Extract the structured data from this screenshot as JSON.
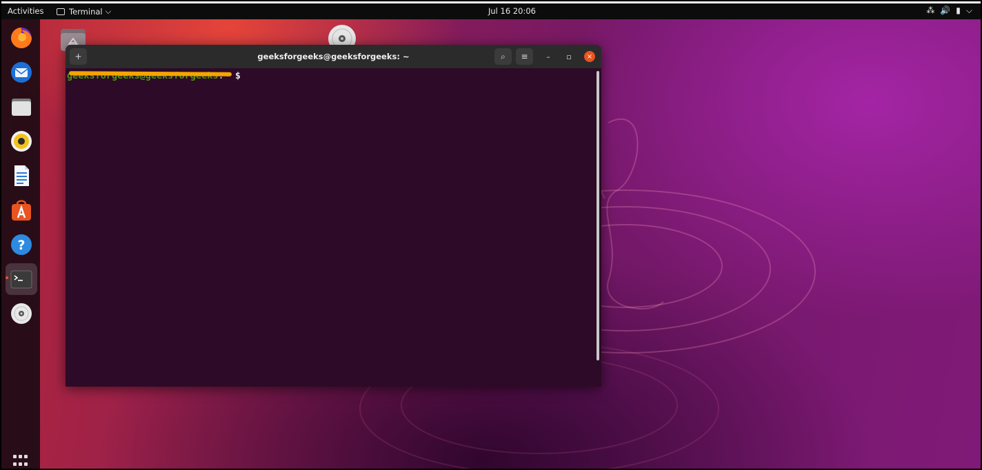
{
  "topbar": {
    "activities": "Activities",
    "app_name": "Terminal",
    "app_chevron": "⌵",
    "clock": "Jul 16  20:06",
    "tray": {
      "network": "⁂",
      "volume": "🔊",
      "battery": "▮",
      "menu": "⌵"
    }
  },
  "dock": {
    "items": [
      {
        "name": "firefox-icon",
        "active": false
      },
      {
        "name": "thunderbird-icon",
        "active": false
      },
      {
        "name": "files-icon",
        "active": false
      },
      {
        "name": "rhythmbox-icon",
        "active": false
      },
      {
        "name": "libreoffice-writer-icon",
        "active": false
      },
      {
        "name": "software-center-icon",
        "active": false
      },
      {
        "name": "help-icon",
        "active": false
      },
      {
        "name": "terminal-icon",
        "active": true
      },
      {
        "name": "dvd-drive-icon",
        "active": false
      }
    ],
    "show_apps": "show-applications-icon"
  },
  "desktop": {
    "icons": [
      "home-folder-icon",
      "disc-icon"
    ]
  },
  "window": {
    "title": "geeksforgeeks@geeksforgeeks: ~",
    "new_tab": "+",
    "search_glyph": "⌕",
    "menu_glyph": "≡",
    "minimize": "–",
    "maximize": "▫",
    "close": "×"
  },
  "terminal": {
    "prompt_user": "geeksforgeeks@geeksforgeeks",
    "prompt_sep": ":",
    "prompt_path": "~",
    "prompt_symbol": "$"
  },
  "colors": {
    "accent": "#e95420",
    "prompt_green": "#4e9a06",
    "terminal_bg": "#2d0a27",
    "redaction": "#f5a500"
  }
}
